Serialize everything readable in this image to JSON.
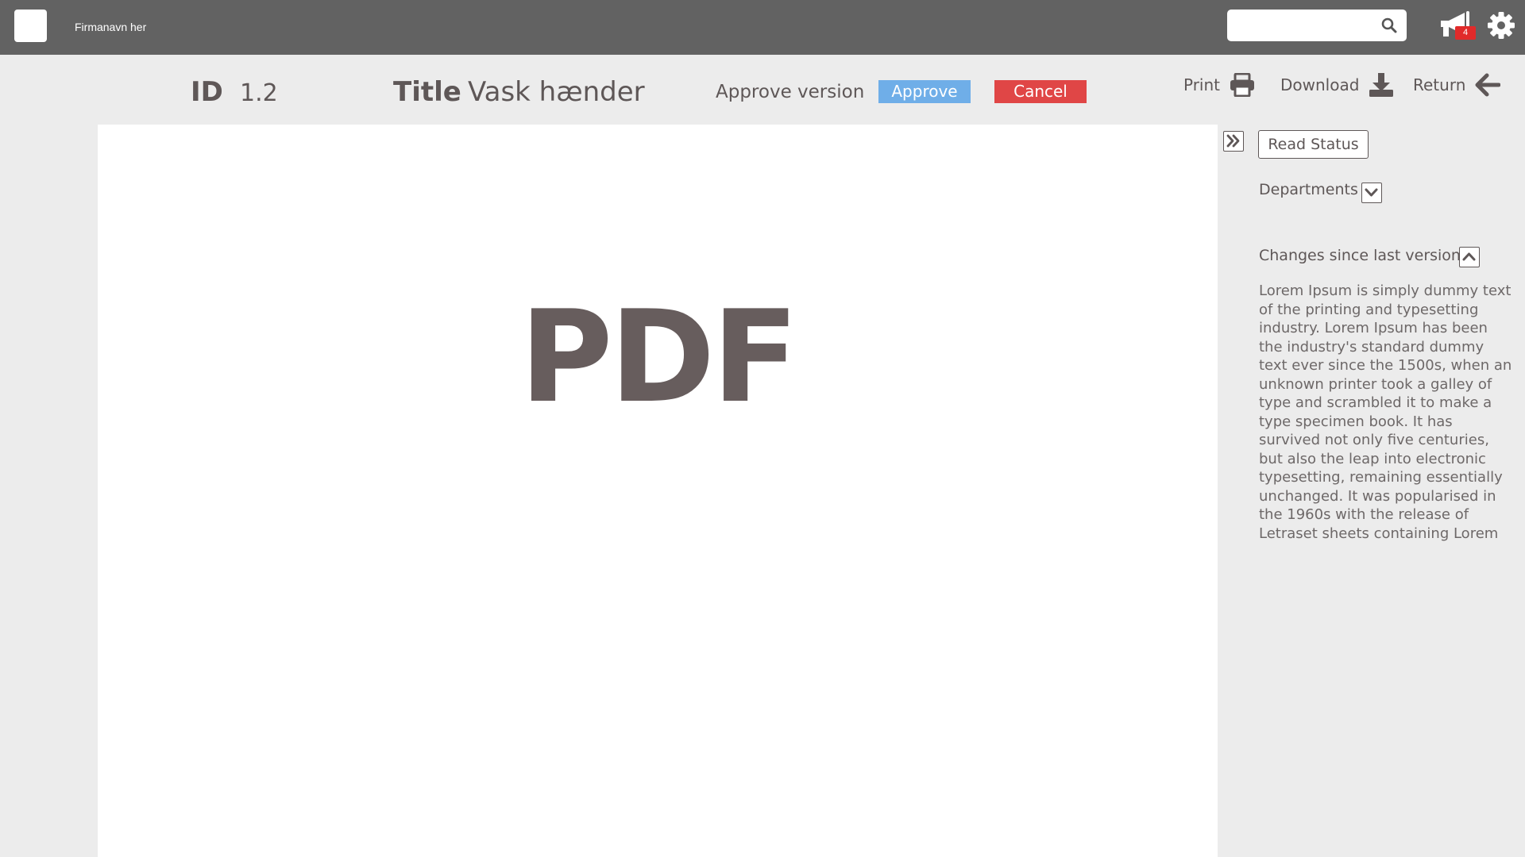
{
  "topbar": {
    "company_name": "Firmanavn her",
    "search": {
      "placeholder": ""
    },
    "notifications": {
      "count": "4"
    }
  },
  "document": {
    "id_label": "ID",
    "id_value": "1.2",
    "title_label": "Title",
    "title_value": "Vask hænder",
    "approve_version_label": "Approve version",
    "approve_button": "Approve",
    "cancel_button": "Cancel"
  },
  "actions": {
    "print": "Print",
    "download": "Download",
    "return": "Return"
  },
  "viewer": {
    "placeholder_text": "PDF"
  },
  "side_panel": {
    "read_status_button": "Read Status",
    "departments_label": "Departments",
    "changes_label": "Changes since last version",
    "changes_text": "Lorem Ipsum is simply dummy text of the printing and typesetting industry. Lorem Ipsum has been the industry's standard dummy text ever since the 1500s, when an unknown printer took a galley of type and scrambled it to make a type specimen book. It has survived not only five centuries, but also the leap into electronic typesetting, remaining essentially unchanged. It was popularised in the 1960s with the release of Letraset sheets containing Lorem"
  },
  "colors": {
    "topbar": "#626262",
    "background": "#ececec",
    "approve": "#6faee8",
    "cancel": "#e04646",
    "badge": "#e12a2a",
    "text": "#5e5757"
  },
  "icons": [
    "search-icon",
    "megaphone-icon",
    "gear-icon",
    "printer-icon",
    "download-icon",
    "arrow-left-icon",
    "double-chevron-right-icon",
    "chevron-down-icon",
    "chevron-up-icon"
  ]
}
